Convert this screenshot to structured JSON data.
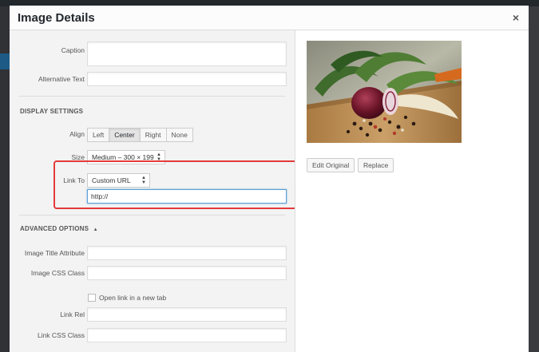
{
  "modal": {
    "title": "Image Details",
    "close_glyph": "×"
  },
  "fields": {
    "caption_label": "Caption",
    "caption_value": "",
    "alt_label": "Alternative Text",
    "alt_value": ""
  },
  "display_settings": {
    "heading": "DISPLAY SETTINGS",
    "align_label": "Align",
    "align_options": [
      "Left",
      "Center",
      "Right",
      "None"
    ],
    "align_selected": "Center",
    "size_label": "Size",
    "size_value": "Medium – 300 × 199",
    "link_to_label": "Link To",
    "link_to_value": "Custom URL",
    "link_url_value": "http://"
  },
  "advanced_options": {
    "heading": "ADVANCED OPTIONS",
    "toggle_glyph": "▲",
    "title_attr_label": "Image Title Attribute",
    "css_class_label": "Image CSS Class",
    "new_tab_label": "Open link in a new tab",
    "new_tab_checked": false,
    "link_rel_label": "Link Rel",
    "link_css_label": "Link CSS Class"
  },
  "image_actions": {
    "edit_original": "Edit Original",
    "replace": "Replace"
  },
  "colors": {
    "highlight": "#e33a3a",
    "title": "#23282d"
  }
}
